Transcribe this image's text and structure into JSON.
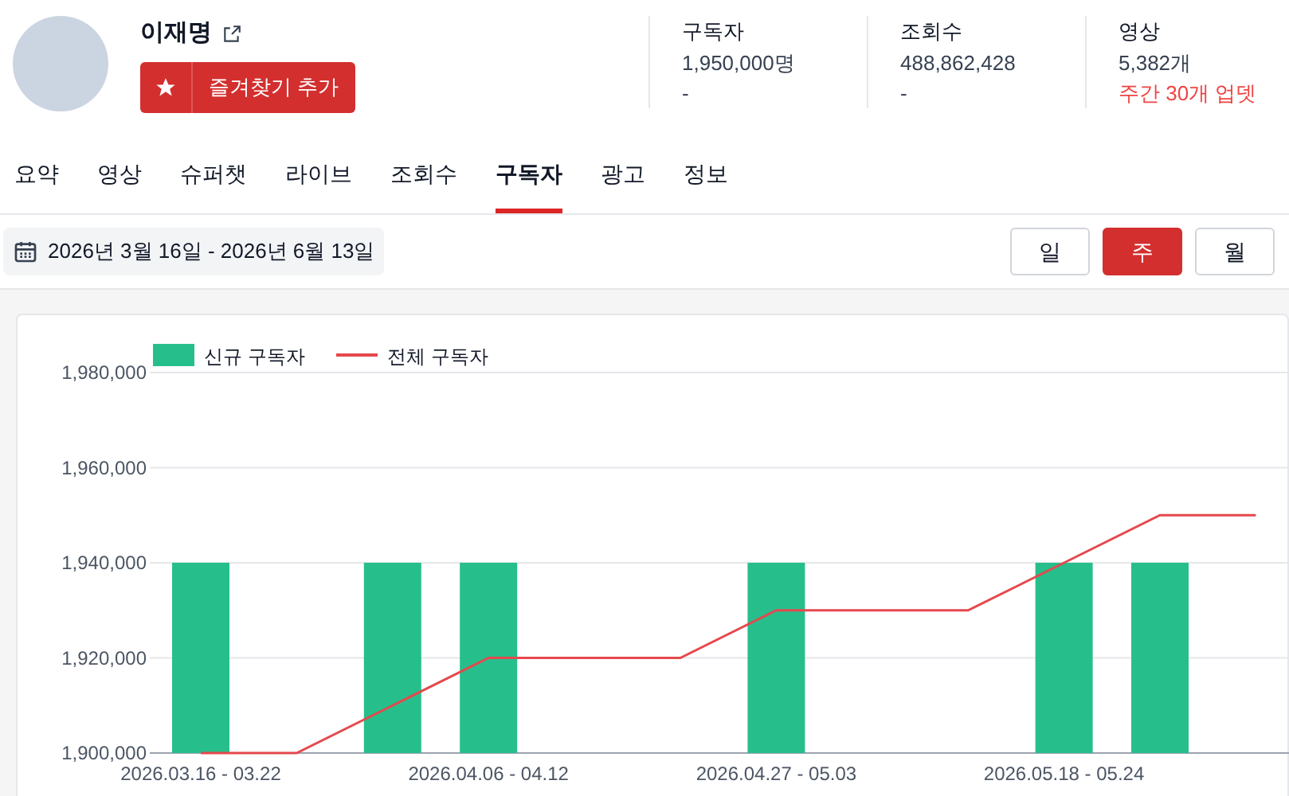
{
  "channel": {
    "name": "이재명",
    "favorite_button": "즐겨찾기 추가"
  },
  "stats": [
    {
      "label": "구독자",
      "value": "1,950,000명",
      "change": "-",
      "kind": "plain"
    },
    {
      "label": "조회수",
      "value": "488,862,428",
      "change": "-",
      "kind": "plain"
    },
    {
      "label": "영상",
      "value": "5,382개",
      "change": "주간 30개 업뎃",
      "kind": "alert"
    }
  ],
  "tabs": [
    {
      "label": "요약",
      "selected": false
    },
    {
      "label": "영상",
      "selected": false
    },
    {
      "label": "슈퍼챗",
      "selected": false
    },
    {
      "label": "라이브",
      "selected": false
    },
    {
      "label": "조회수",
      "selected": false
    },
    {
      "label": "구독자",
      "selected": true
    },
    {
      "label": "광고",
      "selected": false
    },
    {
      "label": "정보",
      "selected": false
    }
  ],
  "date_range": "2026년 3월 16일 - 2026년 6월 13일",
  "period_buttons": [
    {
      "label": "일",
      "selected": false
    },
    {
      "label": "주",
      "selected": true
    },
    {
      "label": "월",
      "selected": false
    }
  ],
  "chart_data": {
    "type": "bar",
    "grid": true,
    "legend": true,
    "categories": [
      "2026.03.16 - 03.22",
      null,
      null,
      "2026.04.06 - 04.12",
      null,
      null,
      "2026.04.27 - 05.03",
      null,
      null,
      "2026.05.18 - 05.24",
      null,
      null
    ],
    "series": [
      {
        "name": "신규 구독자",
        "color": "#26bf8c",
        "values": [
          1940000,
          null,
          1940000,
          1940000,
          null,
          null,
          1940000,
          null,
          null,
          1940000,
          1940000,
          null
        ]
      },
      {
        "name": "전체 구독자",
        "color": "#e5484d",
        "type": "line",
        "values": [
          1900000,
          1900000,
          1910000,
          1920000,
          1920000,
          1920000,
          1930000,
          1930000,
          1930000,
          1940000,
          1950000,
          1950000
        ]
      }
    ],
    "ylim": [
      1900000,
      1980000
    ],
    "yticks": [
      {
        "value": 1900000,
        "label": "1,900,000"
      },
      {
        "value": 1920000,
        "label": "1,920,000"
      },
      {
        "value": 1940000,
        "label": "1,940,000"
      },
      {
        "value": 1960000,
        "label": "1,960,000"
      },
      {
        "value": 1980000,
        "label": "1,980,000"
      }
    ]
  }
}
